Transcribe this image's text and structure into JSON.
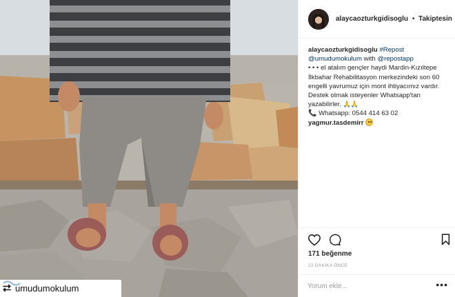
{
  "post": {
    "username": "alaycaozturkgidisoglu",
    "separator": "•",
    "follow_label": "Takiptesin"
  },
  "caption": {
    "username": "alaycaozturkgidisoglu",
    "hashtag": "#Repost",
    "mention1": "@umudumokulum",
    "with_text": "with",
    "mention2": "@repostapp",
    "body": "• • • el atalım gençler haydi Mardin-Kızıltepe İlkbahar Rehabilitasyon merkezindeki son 60 engelli yavrumuz için mont ihtiyacımız vardır. Destek olmak isteyenler Whatsapp'tan yazabilirler.",
    "phone_line": "Whatsapp: 0544 414 63 02"
  },
  "comment": {
    "username": "yagmur.tasdemirr"
  },
  "likes_text": "171 beğenme",
  "time_text": "22 DAKİKA ÖNCE",
  "comment_placeholder": "Yorum ekle...",
  "more_label": "•••",
  "repost_watermark": {
    "username": "umudumokulum"
  },
  "icons": {
    "like": "heart-icon",
    "comment": "comment-bubble-icon",
    "save": "bookmark-icon",
    "repost": "repost-icon",
    "phone": "telephone-icon"
  },
  "colors": {
    "link": "#003569",
    "text": "#262626",
    "muted": "#999999",
    "divider": "#efefef"
  }
}
